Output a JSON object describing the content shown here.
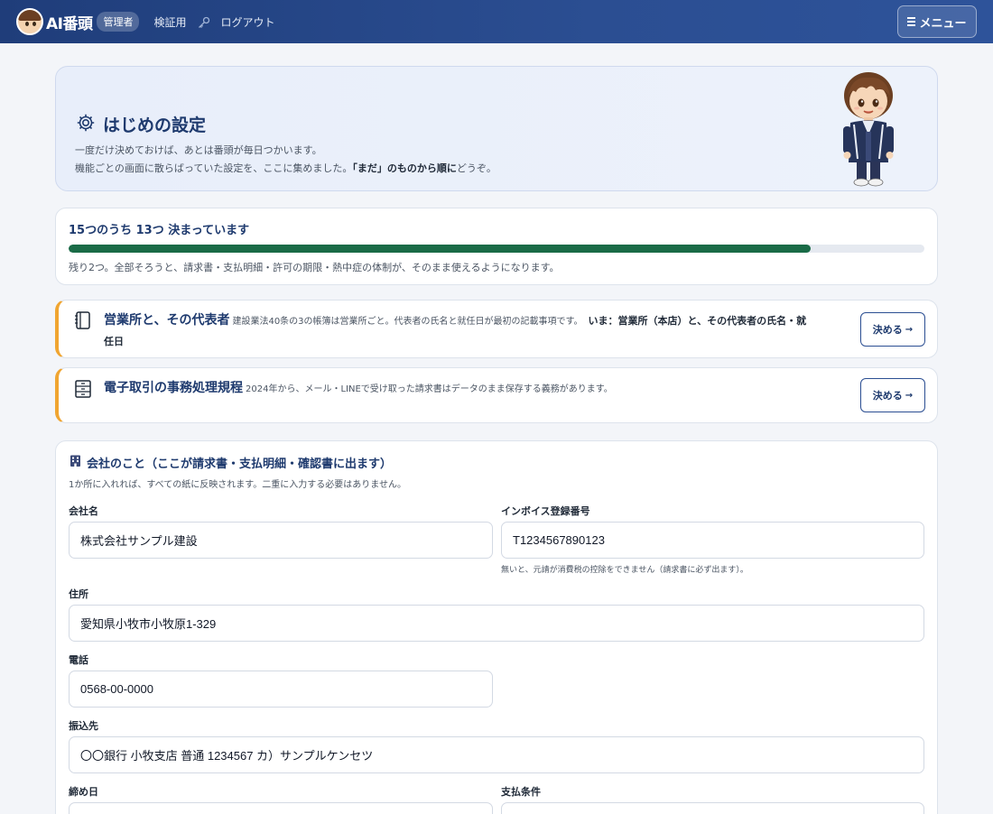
{
  "navbar": {
    "brand": "AI番頭",
    "role_badge": "管理者",
    "link_test": "検証用",
    "link_logout": "ログアウト",
    "menu_label": "メニュー"
  },
  "hero": {
    "title": "はじめの設定",
    "desc_line1": "一度だけ決めておけば、あとは番頭が毎日つかいます。",
    "desc_line2_prefix": "機能ごとの画面に散らばっていた設定を、ここに集めました。",
    "desc_line2_bold": "「まだ」のものから順に",
    "desc_line2_suffix": "どうぞ。"
  },
  "progress": {
    "title": "15つのうち 13つ 決まっています",
    "done": 13,
    "total": 15,
    "note": "残り2つ。全部そろうと、請求書・支払明細・許可の期限・熱中症の体制が、そのまま使えるようになります。"
  },
  "todos": [
    {
      "icon": "notebook-icon",
      "title": "営業所と、その代表者",
      "desc": "建設業法40条の3の帳簿は営業所ごと。代表者の氏名と就任日が最初の記載事項です。",
      "now": "いま：営業所（本店）と、その代表者の氏名・就任日",
      "button": "決める"
    },
    {
      "icon": "file-cabinet-icon",
      "title": "電子取引の事務処理規程",
      "desc": "2024年から、メール・LINEで受け取った請求書はデータのまま保存する義務があります。",
      "now": "",
      "button": "決める"
    }
  ],
  "company_form": {
    "title": "会社のこと（ここが請求書・支払明細・確認書に出ます）",
    "subtitle": "1か所に入れれば、すべての紙に反映されます。二重に入力する必要はありません。",
    "fields": {
      "company_name": {
        "label": "会社名",
        "value": "株式会社サンプル建設"
      },
      "invoice_number": {
        "label": "インボイス登録番号",
        "value": "T1234567890123",
        "hint": "無いと、元請が消費税の控除をできません（請求書に必ず出ます）。"
      },
      "address": {
        "label": "住所",
        "value": "愛知県小牧市小牧原1-329"
      },
      "phone": {
        "label": "電話",
        "value": "0568-00-0000"
      },
      "bank": {
        "label": "振込先",
        "value": "〇〇銀行 小牧支店 普通 1234567 カ）サンプルケンセツ"
      },
      "closing_day": {
        "label": "締め日",
        "value": ""
      },
      "payment_terms": {
        "label": "支払条件",
        "value": ""
      }
    }
  },
  "colors": {
    "nav_bg": "#1f3d7a",
    "accent": "#1e3a6e",
    "progress_fill": "#1a6b47",
    "todo_border": "#f0a531"
  }
}
